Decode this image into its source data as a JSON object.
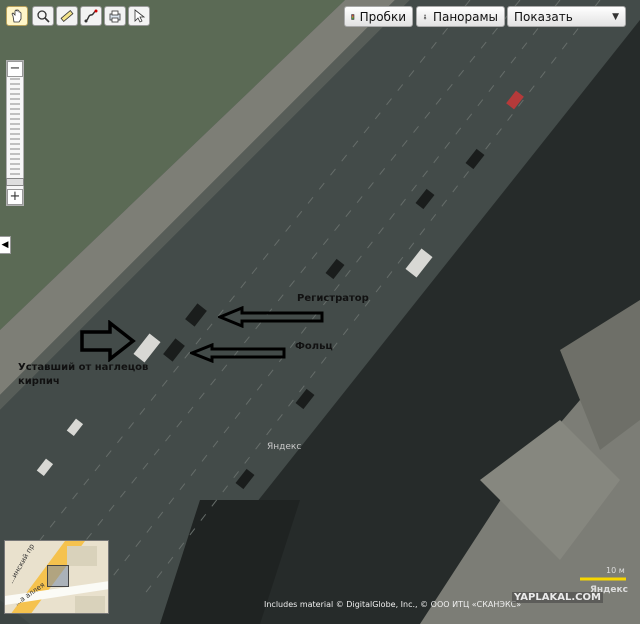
{
  "toolbar": {
    "tools": [
      "hand-icon",
      "magnifier-icon",
      "ruler-icon",
      "route-icon",
      "print-icon",
      "pointer-icon"
    ],
    "traffic_label": "Пробки",
    "panorama_label": "Панорамы",
    "show_select": {
      "value": "Показать"
    }
  },
  "annotations": {
    "registrar": "Регистратор",
    "folts": "Фольц",
    "tired_line1": "Уставший от наглецов",
    "tired_line2": "кирпич"
  },
  "map": {
    "watermark": "Яндекс",
    "scale_label": "10 м",
    "copyright": "Includes material © DigitalGlobe, Inc., © ООО ИТЦ «СКАНЭКС»",
    "site_watermark": "YAPLAKAL.COM",
    "logo": "Яндекс"
  },
  "minimap": {
    "label1": "...инский пр",
    "label2": "...а аллея"
  },
  "colors": {
    "road": "#3c4442",
    "sidewalk": "#7d7e76",
    "grass": "#5c6a56",
    "building": "#7f8078",
    "scale_bar": "#f7d600"
  }
}
